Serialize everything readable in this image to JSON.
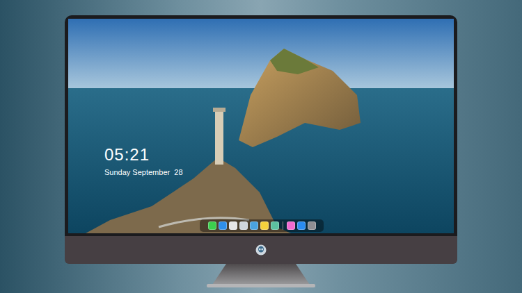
{
  "clock": {
    "time": "05:21",
    "date": "Sunday September  28"
  },
  "dock": {
    "items": [
      {
        "kind": "app",
        "color": "#3ccf4e"
      },
      {
        "kind": "app",
        "color": "#2f8fe8"
      },
      {
        "kind": "app",
        "color": "#e6e6e6"
      },
      {
        "kind": "app",
        "color": "#cfd6dc"
      },
      {
        "kind": "app",
        "color": "#4aa3df"
      },
      {
        "kind": "app",
        "color": "#f5d23c"
      },
      {
        "kind": "app",
        "color": "#5cc1a0"
      },
      {
        "kind": "separator",
        "color": "#8a8a8a"
      },
      {
        "kind": "app",
        "color": "#f06bd0"
      },
      {
        "kind": "app",
        "color": "#2a8cf0"
      },
      {
        "kind": "app",
        "color": "#8e8e93"
      }
    ]
  }
}
